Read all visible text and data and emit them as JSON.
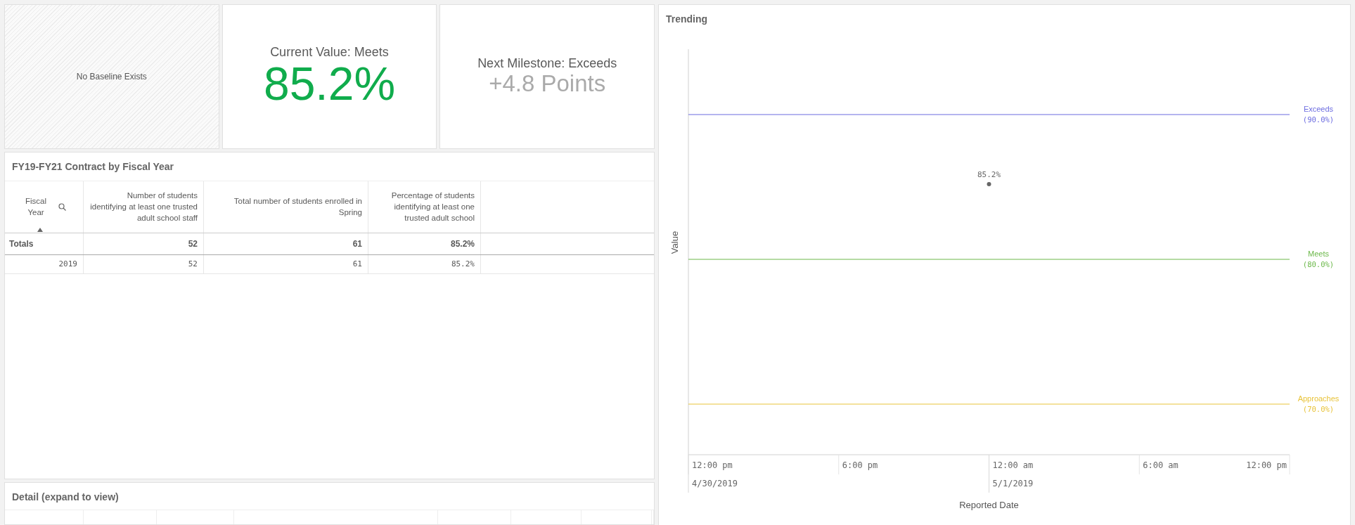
{
  "kpis": {
    "baseline": {
      "text": "No Baseline Exists"
    },
    "current": {
      "label": "Current Value: Meets",
      "value": "85.2%"
    },
    "milestone": {
      "label": "Next Milestone: Exceeds",
      "value": "+4.8 Points"
    }
  },
  "table": {
    "title": "FY19-FY21 Contract by Fiscal Year",
    "columns": [
      {
        "label": "Fiscal Year",
        "searchable": true,
        "sorted": true
      },
      {
        "label": "Number of students identifying at least one trusted adult school staff",
        "searchable": false,
        "sorted": false
      },
      {
        "label": "Total number of students enrolled in Spring",
        "searchable": false,
        "sorted": false
      },
      {
        "label": "Percentage of students identifying at least one trusted adult school",
        "searchable": false,
        "sorted": false
      }
    ],
    "totals": {
      "label": "Totals",
      "cells": [
        "52",
        "61",
        "85.2%"
      ]
    },
    "rows": [
      [
        "2019",
        "52",
        "61",
        "85.2%"
      ]
    ]
  },
  "detail": {
    "title": "Detail (expand to view)"
  },
  "trending": {
    "title": "Trending",
    "y_axis_title": "Value",
    "x_axis_title": "Reported Date",
    "point_label": "85.2%",
    "reference_lines": [
      {
        "label": "Exceeds",
        "value_label": "(90.0%)",
        "color": "#6c6ce0"
      },
      {
        "label": "Meets",
        "value_label": "(80.0%)",
        "color": "#6cb84a"
      },
      {
        "label": "Approaches",
        "value_label": "(70.0%)",
        "color": "#e8c33a"
      }
    ],
    "time_ticks": [
      "12:00 pm",
      "6:00 pm",
      "12:00 am",
      "6:00 am",
      "12:00 pm"
    ],
    "date_labels": [
      "4/30/2019",
      "5/1/2019"
    ]
  }
}
